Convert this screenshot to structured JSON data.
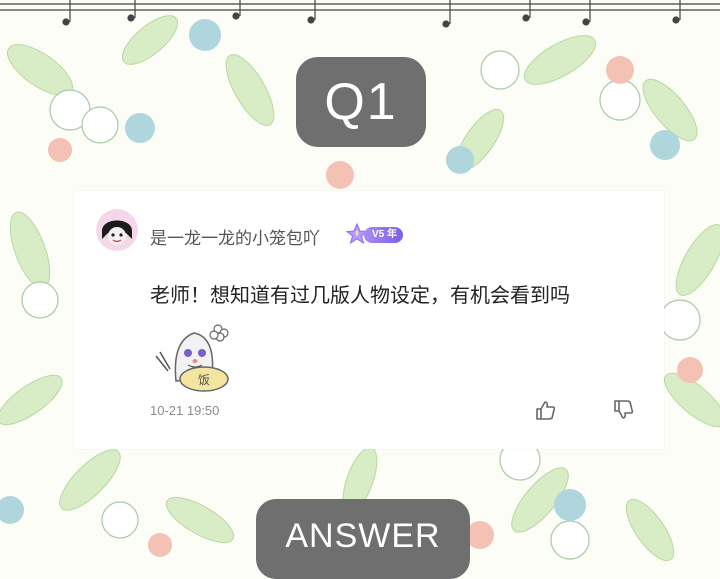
{
  "header": {
    "question_label": "Q1"
  },
  "comment": {
    "username": "是一龙一龙的小笼包吖",
    "level_badge": "V5 年",
    "text": "老师！想知道有过几版人物设定，有机会看到吗",
    "timestamp": "10-21 19:50",
    "sticker_text": "饭"
  },
  "footer": {
    "answer_label": "ANSWER"
  },
  "colors": {
    "background": "#fbfdf6",
    "badge_gray": "#6f6f6f",
    "level_purple": "#7d5ee6",
    "leaf_green": "#cfe8b8",
    "berry_blue": "#aed6dc",
    "berry_pink": "#f3c2b4"
  }
}
